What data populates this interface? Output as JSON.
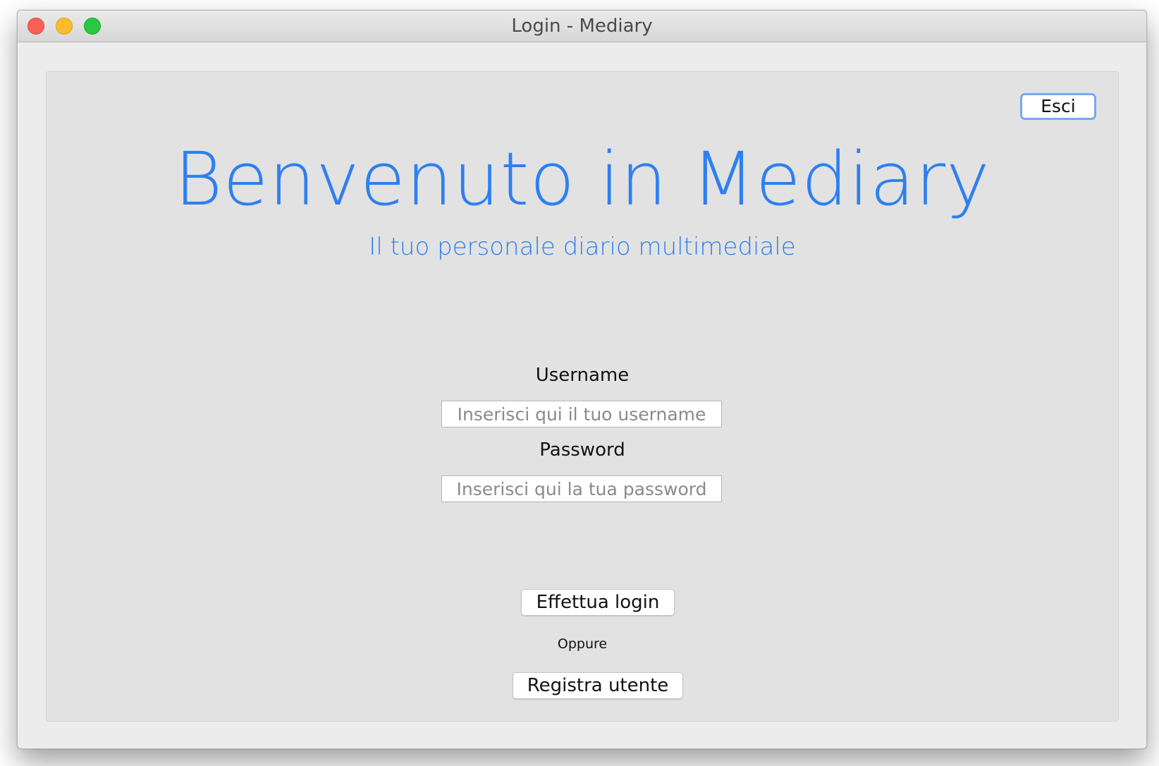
{
  "window": {
    "title": "Login - Mediary"
  },
  "toolbar": {
    "exit_label": "Esci"
  },
  "hero": {
    "title": "Benvenuto in Mediary",
    "subtitle": "Il tuo personale diario multimediale"
  },
  "form": {
    "username_label": "Username",
    "username_placeholder": "Inserisci qui il tuo username",
    "username_value": "",
    "password_label": "Password",
    "password_placeholder": "Inserisci qui la tua password",
    "password_value": ""
  },
  "actions": {
    "login_label": "Effettua login",
    "or_label": "Oppure",
    "register_label": "Registra utente"
  },
  "colors": {
    "accent": "#2e7ff0",
    "focus_ring": "#76a9ef",
    "close": "#fc5f57",
    "minimize": "#fdbc2e",
    "maximize": "#28c840"
  }
}
